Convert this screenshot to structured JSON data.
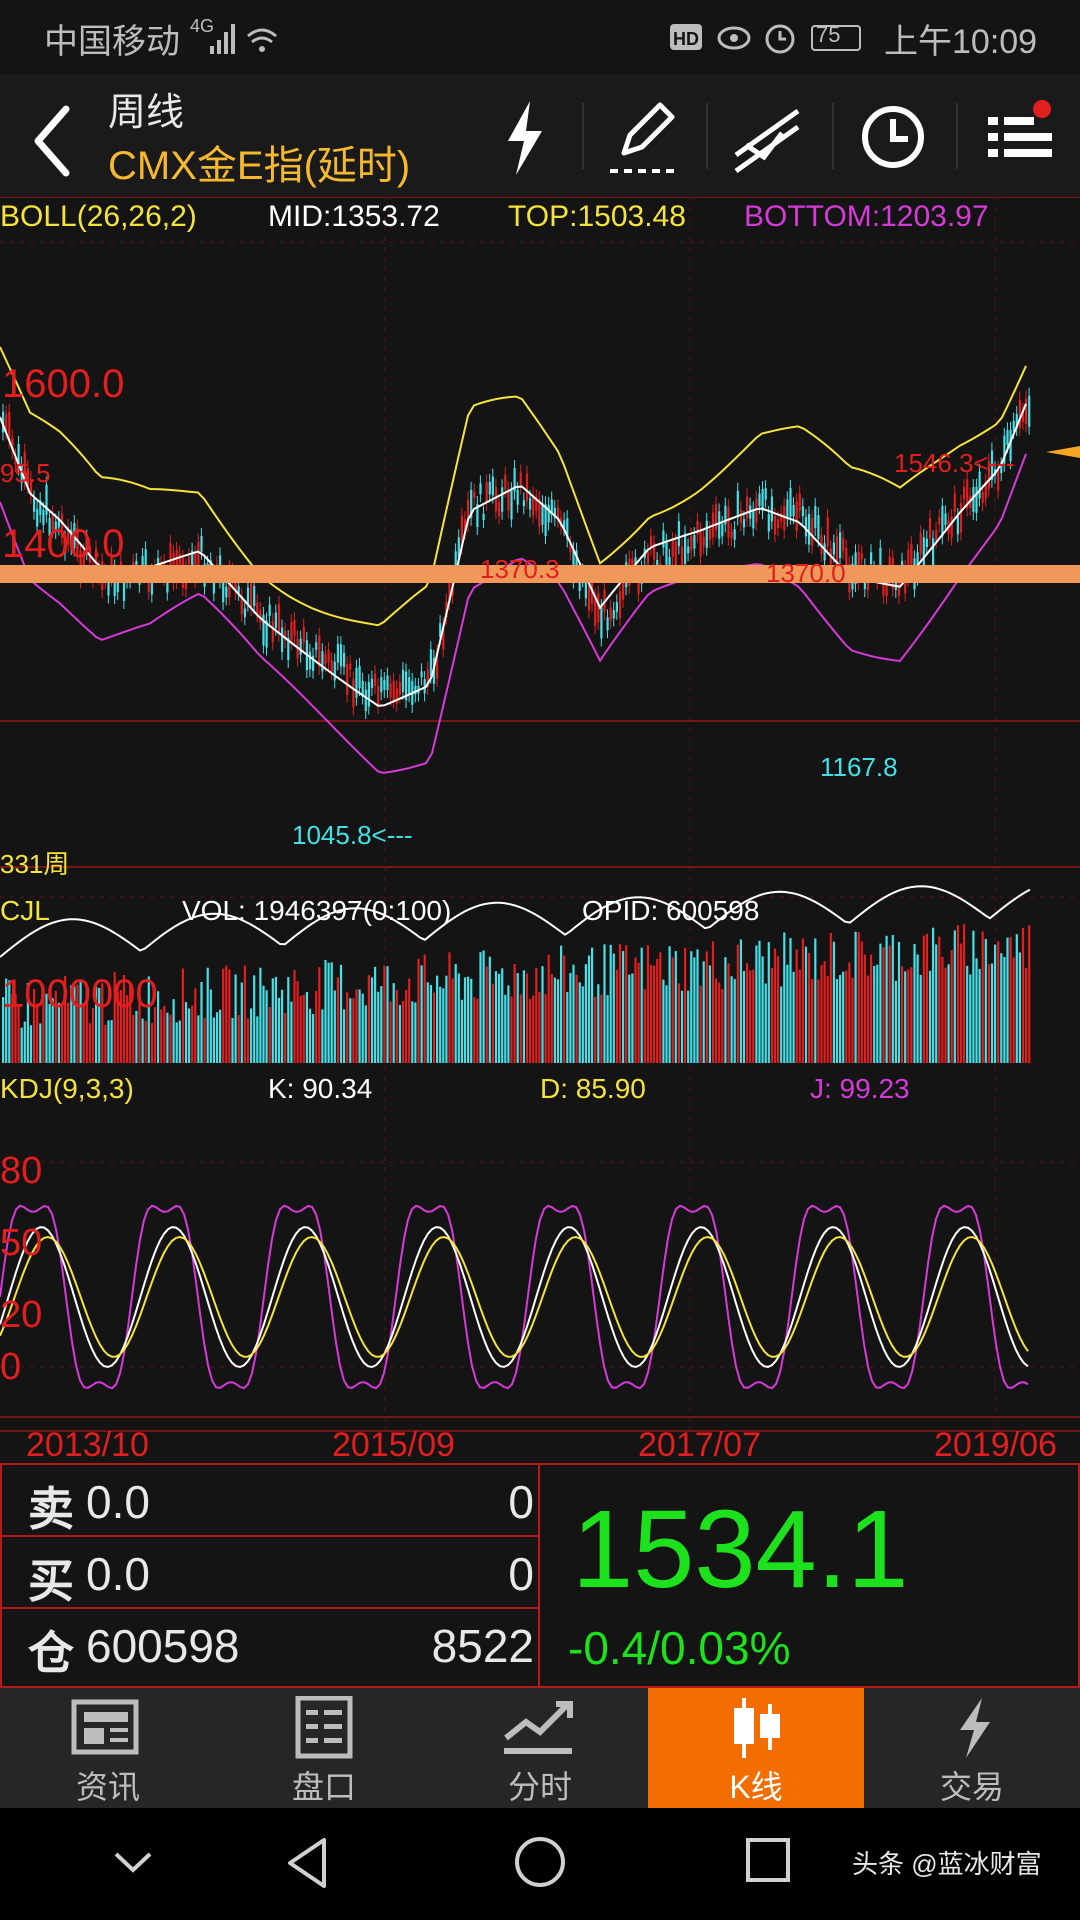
{
  "status_bar": {
    "carrier": "中国移动",
    "network": "4G",
    "battery": "75",
    "time": "上午10:09"
  },
  "header": {
    "period": "周线",
    "instrument": "CMX金E指(延时)",
    "icons": [
      "back-icon",
      "lightning-icon",
      "draw-icon",
      "trendline-icon",
      "clock-icon",
      "menu-icon"
    ]
  },
  "boll": {
    "name": "BOLL(26,26,2)",
    "mid": "MID:1353.72",
    "top": "TOP:1503.48",
    "bottom": "BOTTOM:1203.97",
    "price_labels": [
      "1600.0",
      "1400.0",
      "95.5"
    ],
    "annotations": {
      "high": "1546.3<---",
      "low1": "1045.8<---",
      "low2": "1167.8",
      "hidden1": "1370.3",
      "hidden2": "1370.0"
    },
    "period_count": "331周"
  },
  "volume": {
    "name": "CJL",
    "vol": "VOL: 1946397(0:100)",
    "opid": "OPID: 600598",
    "axis_label": "1000000"
  },
  "kdj": {
    "name": "KDJ(9,3,3)",
    "k": "K: 90.34",
    "d": "D: 85.90",
    "j": "J: 99.23",
    "axis_labels": [
      "80",
      "50",
      "20",
      "0"
    ]
  },
  "dates": [
    "2013/10",
    "2015/09",
    "2017/07",
    "2019/06"
  ],
  "quote": {
    "sell_label": "卖",
    "sell_price": "0.0",
    "sell_qty": "0",
    "buy_label": "买",
    "buy_price": "0.0",
    "buy_qty": "0",
    "oi_label": "仓",
    "oi_value": "600598",
    "oi_change": "8522",
    "last_price": "1534.1",
    "change": "-0.4/0.03%"
  },
  "tabs": [
    {
      "label": "资讯",
      "icon": "news-icon"
    },
    {
      "label": "盘口",
      "icon": "orderbook-icon"
    },
    {
      "label": "分时",
      "icon": "intraday-icon"
    },
    {
      "label": "K线",
      "icon": "candlestick-icon",
      "active": true
    },
    {
      "label": "交易",
      "icon": "trade-icon"
    }
  ],
  "watermark": "头条 @蓝冰财富",
  "colors": {
    "accent_orange": "#f36d00",
    "highlight_band": "#f0975a",
    "up_red": "#e21e1e",
    "down_cyan": "#44e0e8",
    "boll_yellow": "#f5e33c",
    "boll_magenta": "#d63ad9",
    "price_green": "#1de11d"
  }
}
